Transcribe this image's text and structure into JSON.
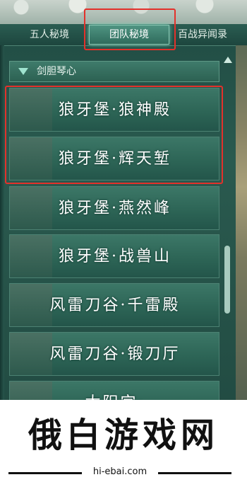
{
  "tabs": [
    {
      "label": "五人秘境"
    },
    {
      "label": "团队秘境",
      "selected": true
    },
    {
      "label": "百战异闻录"
    }
  ],
  "group": {
    "label": "剑胆琴心",
    "expanded": true
  },
  "items": [
    {
      "label": "狼牙堡·狼神殿"
    },
    {
      "label": "狼牙堡·辉天堑"
    },
    {
      "label": "狼牙堡·燕然峰"
    },
    {
      "label": "狼牙堡·战兽山"
    },
    {
      "label": "风雷刀谷·千雷殿"
    },
    {
      "label": "风雷刀谷·锻刀厅"
    },
    {
      "label": "太阳宫·"
    }
  ],
  "highlight_color": "#e3312b",
  "accent": "#4f9482",
  "watermark": {
    "title": "俄白游戏网",
    "url": "hi-ebai.com"
  }
}
